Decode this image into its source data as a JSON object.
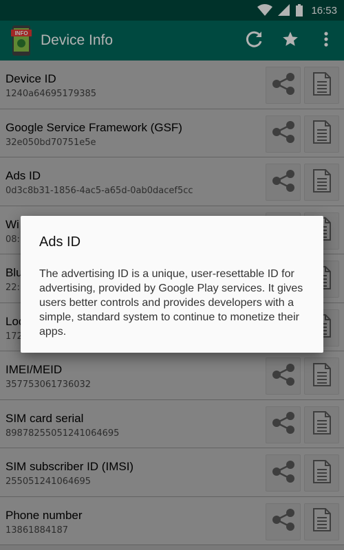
{
  "status_bar": {
    "time": "16:53"
  },
  "toolbar": {
    "title": "Device Info",
    "logo_text": "INFO",
    "icons": [
      "refresh-icon",
      "star-icon",
      "more-vert-icon"
    ]
  },
  "rows": [
    {
      "label": "Device ID",
      "value": "1240a64695179385"
    },
    {
      "label": "Google Service Framework (GSF)",
      "value": "32e050bd70751e5e"
    },
    {
      "label": "Ads ID",
      "value": "0d3c8b31-1856-4ac5-a65d-0ab0dacef5cc"
    },
    {
      "label": "Wi",
      "value": "08:"
    },
    {
      "label": "Blu",
      "value": "22:"
    },
    {
      "label": "Loc",
      "value": "172"
    },
    {
      "label": "IMEI/MEID",
      "value": "357753061736032"
    },
    {
      "label": "SIM card serial",
      "value": "89878255051241064695"
    },
    {
      "label": "SIM subscriber ID (IMSI)",
      "value": "255051241064695"
    },
    {
      "label": "Phone number",
      "value": "13861884187"
    }
  ],
  "dialog": {
    "title": "Ads ID",
    "body": "The advertising ID is a unique, user-resettable ID for advertising, provided by Google Play services. It gives users better controls and provides developers with a simple, standard system to continue to monetize their apps."
  },
  "colors": {
    "status_bar": "#00483d",
    "toolbar": "#00695c"
  }
}
